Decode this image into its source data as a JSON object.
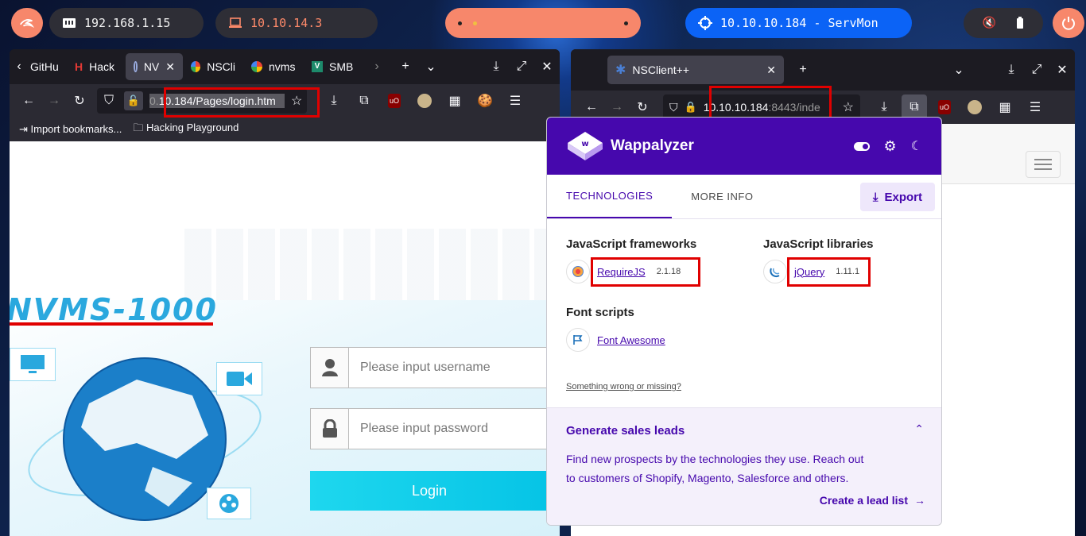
{
  "topbar": {
    "ip_local": "192.168.1.15",
    "ip_vpn": "10.10.14.3",
    "target": "10.10.10.184 - ServMon",
    "colors": {
      "kali_pill": "#f7876b",
      "dark_pill": "#2e2e36",
      "vpn_text": "#ff8a6a",
      "target_pill": "#0b63f6",
      "power": "#f7876b"
    }
  },
  "left_browser": {
    "tabs": [
      "GitHu",
      "Hack",
      "NV",
      "NSCli",
      "nvms",
      "SMB"
    ],
    "url_display": "10.184/Pages/login.htm",
    "url_prefix": "0.",
    "bookmarks": [
      "Import bookmarks...",
      "Hacking Playground"
    ],
    "page": {
      "logo": "NVMS-1000",
      "username_placeholder": "Please input username",
      "password_placeholder": "Please input password",
      "login_label": "Login"
    }
  },
  "right_browser": {
    "tab_title": "NSClient++",
    "url_host": "10.10.10.184",
    "url_rest": ":8443/inde"
  },
  "wappalyzer": {
    "brand": "Wappalyzer",
    "tabs": [
      "TECHNOLOGIES",
      "MORE INFO"
    ],
    "export_label": "Export",
    "categories": {
      "js_frameworks": {
        "title": "JavaScript frameworks",
        "name": "RequireJS",
        "version": "2.1.18"
      },
      "js_libraries": {
        "title": "JavaScript libraries",
        "name": "jQuery",
        "version": "1.11.1"
      },
      "font_scripts": {
        "title": "Font scripts",
        "name": "Font Awesome"
      }
    },
    "wrong_link": "Something wrong or missing?",
    "footer": {
      "title": "Generate sales leads",
      "body_line1": "Find new prospects by the technologies they use. Reach out",
      "body_line2": "to customers of Shopify, Magento, Salesforce and others.",
      "cta": "Create a lead list"
    },
    "colors": {
      "primary": "#4608ad"
    }
  }
}
